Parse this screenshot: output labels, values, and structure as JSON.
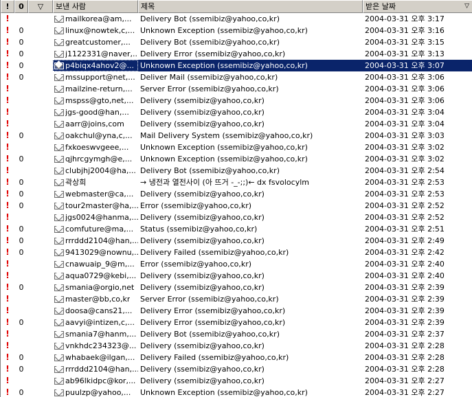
{
  "header": {
    "importance_glyph": "!",
    "attachment_glyph": "0",
    "flag_glyph": "▽",
    "from_label": "보낸 사람",
    "subject_label": "제목",
    "received_label": "받은 날짜",
    "sort_indicator": "▽"
  },
  "messages": [
    {
      "imp": "!",
      "att": "",
      "from": "mailkorea@am,...",
      "subject": "Delivery Bot (ssemibiz@yahoo,co,kr)",
      "date": "2004-03-31 오후 3:17"
    },
    {
      "imp": "!",
      "att": "0",
      "from": "linux@nowtek,c,...",
      "subject": "Unknown Exception (ssemibiz@yahoo,co,kr)",
      "date": "2004-03-31 오후 3:16"
    },
    {
      "imp": "!",
      "att": "0",
      "from": "greatcustomer,...",
      "subject": "Delivery Bot (ssemibiz@yahoo,co,kr)",
      "date": "2004-03-31 오후 3:15"
    },
    {
      "imp": "!",
      "att": "0",
      "from": "j1122331@naver,...",
      "subject": "Delivery Error (ssemibiz@yahoo,co,kr)",
      "date": "2004-03-31 오후 3:13"
    },
    {
      "imp": "!",
      "att": "0",
      "from": "p4biqx4ahov2@...",
      "subject": "Unknown Exception (ssemibiz@yahoo,co,kr)",
      "date": "2004-03-31 오후 3:07",
      "selected": true
    },
    {
      "imp": "!",
      "att": "0",
      "from": "mssupport@net,...",
      "subject": "Deliver Mail (ssemibiz@yahoo,co,kr)",
      "date": "2004-03-31 오후 3:06"
    },
    {
      "imp": "!",
      "att": "",
      "from": "mailzine-return,...",
      "subject": "Server Error (ssemibiz@yahoo,co,kr)",
      "date": "2004-03-31 오후 3:06"
    },
    {
      "imp": "!",
      "att": "",
      "from": "mspss@gto,net,...",
      "subject": "Delivery (ssemibiz@yahoo,co,kr)",
      "date": "2004-03-31 오후 3:06"
    },
    {
      "imp": "!",
      "att": "",
      "from": "jgs-good@han,...",
      "subject": "Delivery (ssemibiz@yahoo,co,kr)",
      "date": "2004-03-31 오후 3:04"
    },
    {
      "imp": "!",
      "att": "",
      "from": "aarr@joins,com",
      "subject": "Delivery (ssemibiz@yahoo,co,kr)",
      "date": "2004-03-31 오후 3:04"
    },
    {
      "imp": "!",
      "att": "0",
      "from": "oakchul@yna,c,...",
      "subject": "Mail Delivery System (ssemibiz@yahoo,co,kr)",
      "date": "2004-03-31 오후 3:03"
    },
    {
      "imp": "!",
      "att": "",
      "from": "fxkoeswvgeee,...",
      "subject": "Unknown Exception (ssemibiz@yahoo,co,kr)",
      "date": "2004-03-31 오후 3:02"
    },
    {
      "imp": "!",
      "att": "0",
      "from": "qjhrcgymgh@e,...",
      "subject": "Unknown Exception (ssemibiz@yahoo,co,kr)",
      "date": "2004-03-31 오후 3:02"
    },
    {
      "imp": "!",
      "att": "",
      "from": "clubjhj2004@ha,...",
      "subject": "Delivery Bot (ssemibiz@yahoo,co,kr)",
      "date": "2004-03-31 오후 2:54"
    },
    {
      "imp": "!",
      "att": "0",
      "from": "곽상희",
      "subject": "→ 냉전과 열전사이 (아 뜨거 -_-;;)← dx fsvolocylm",
      "date": "2004-03-31 오후 2:53"
    },
    {
      "imp": "!",
      "att": "0",
      "from": "webmaster@ca,...",
      "subject": "Delivery (ssemibiz@yahoo,co,kr)",
      "date": "2004-03-31 오후 2:53"
    },
    {
      "imp": "!",
      "att": "0",
      "from": "tour2master@ha,...",
      "subject": "Error (ssemibiz@yahoo,co,kr)",
      "date": "2004-03-31 오후 2:52"
    },
    {
      "imp": "!",
      "att": "",
      "from": "jgs0024@hanma,...",
      "subject": "Delivery (ssemibiz@yahoo,co,kr)",
      "date": "2004-03-31 오후 2:52"
    },
    {
      "imp": "!",
      "att": "0",
      "from": "comfuture@ma,...",
      "subject": "Status (ssemibiz@yahoo,co,kr)",
      "date": "2004-03-31 오후 2:51"
    },
    {
      "imp": "!",
      "att": "0",
      "from": "rrrddd2104@han,...",
      "subject": "Delivery (ssemibiz@yahoo,co,kr)",
      "date": "2004-03-31 오후 2:49"
    },
    {
      "imp": "!",
      "att": "0",
      "from": "9413029@nownu,...",
      "subject": "Delivery Failed (ssemibiz@yahoo,co,kr)",
      "date": "2004-03-31 오후 2:42"
    },
    {
      "imp": "!",
      "att": "",
      "from": "cnawuaip_9@m,...",
      "subject": "Error (ssemibiz@yahoo,co,kr)",
      "date": "2004-03-31 오후 2:40"
    },
    {
      "imp": "!",
      "att": "",
      "from": "aqua0729@kebi,...",
      "subject": "Delivery (ssemibiz@yahoo,co,kr)",
      "date": "2004-03-31 오후 2:40"
    },
    {
      "imp": "!",
      "att": "0",
      "from": "smania@orgio,net",
      "subject": "Delivery (ssemibiz@yahoo,co,kr)",
      "date": "2004-03-31 오후 2:39"
    },
    {
      "imp": "!",
      "att": "",
      "from": "master@bb,co,kr",
      "subject": "Server Error (ssemibiz@yahoo,co,kr)",
      "date": "2004-03-31 오후 2:39"
    },
    {
      "imp": "!",
      "att": "",
      "from": "doosa@cans21,...",
      "subject": "Delivery Error (ssemibiz@yahoo,co,kr)",
      "date": "2004-03-31 오후 2:39"
    },
    {
      "imp": "!",
      "att": "0",
      "from": "aavyi@intizen,c,...",
      "subject": "Delivery Error (ssemibiz@yahoo,co,kr)",
      "date": "2004-03-31 오후 2:39"
    },
    {
      "imp": "!",
      "att": "",
      "from": "smania7@hanm,...",
      "subject": "Delivery Bot (ssemibiz@yahoo,co,kr)",
      "date": "2004-03-31 오후 2:37"
    },
    {
      "imp": "!",
      "att": "",
      "from": "vnkhdc234323@...",
      "subject": "Delivery (ssemibiz@yahoo,co,kr)",
      "date": "2004-03-31 오후 2:28"
    },
    {
      "imp": "!",
      "att": "0",
      "from": "whabaek@ilgan,...",
      "subject": "Delivery Failed (ssemibiz@yahoo,co,kr)",
      "date": "2004-03-31 오후 2:28"
    },
    {
      "imp": "!",
      "att": "0",
      "from": "rrrddd2104@han,...",
      "subject": "Delivery (ssemibiz@yahoo,co,kr)",
      "date": "2004-03-31 오후 2:28"
    },
    {
      "imp": "!",
      "att": "",
      "from": "ab96lkidpc@kor,...",
      "subject": "Delivery (ssemibiz@yahoo,co,kr)",
      "date": "2004-03-31 오후 2:27"
    },
    {
      "imp": "!",
      "att": "0",
      "from": "puulzp@yahoo,...",
      "subject": "Unknown Exception (ssemibiz@yahoo,co,kr)",
      "date": "2004-03-31 오후 2:27"
    }
  ]
}
